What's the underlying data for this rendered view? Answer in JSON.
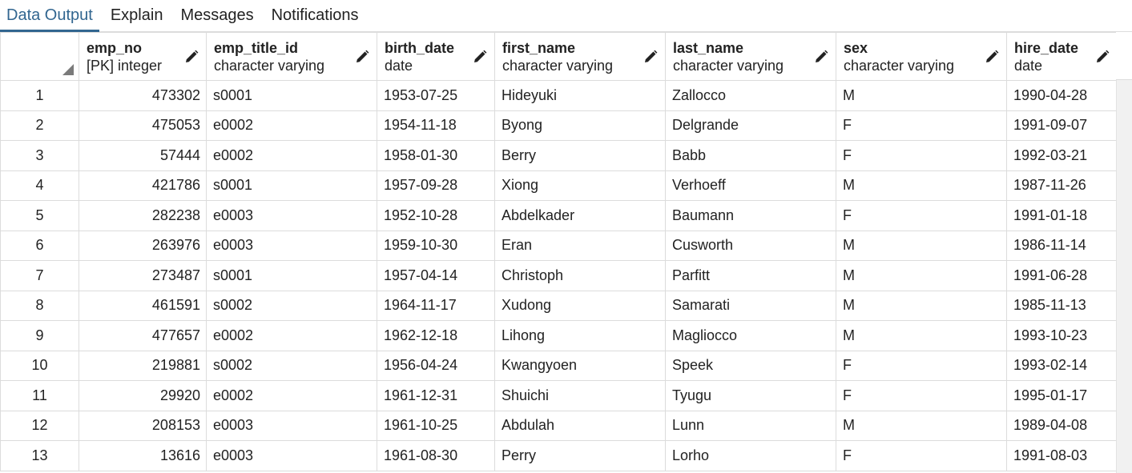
{
  "tabs": [
    {
      "label": "Data Output",
      "active": true
    },
    {
      "label": "Explain",
      "active": false
    },
    {
      "label": "Messages",
      "active": false
    },
    {
      "label": "Notifications",
      "active": false
    }
  ],
  "columns": [
    {
      "name": "emp_no",
      "type": "[PK] integer"
    },
    {
      "name": "emp_title_id",
      "type": "character varying"
    },
    {
      "name": "birth_date",
      "type": "date"
    },
    {
      "name": "first_name",
      "type": "character varying"
    },
    {
      "name": "last_name",
      "type": "character varying"
    },
    {
      "name": "sex",
      "type": "character varying"
    },
    {
      "name": "hire_date",
      "type": "date"
    }
  ],
  "rows": [
    [
      "1",
      "473302",
      "s0001",
      "1953-07-25",
      "Hideyuki",
      "Zallocco",
      "M",
      "1990-04-28"
    ],
    [
      "2",
      "475053",
      "e0002",
      "1954-11-18",
      "Byong",
      "Delgrande",
      "F",
      "1991-09-07"
    ],
    [
      "3",
      "57444",
      "e0002",
      "1958-01-30",
      "Berry",
      "Babb",
      "F",
      "1992-03-21"
    ],
    [
      "4",
      "421786",
      "s0001",
      "1957-09-28",
      "Xiong",
      "Verhoeff",
      "M",
      "1987-11-26"
    ],
    [
      "5",
      "282238",
      "e0003",
      "1952-10-28",
      "Abdelkader",
      "Baumann",
      "F",
      "1991-01-18"
    ],
    [
      "6",
      "263976",
      "e0003",
      "1959-10-30",
      "Eran",
      "Cusworth",
      "M",
      "1986-11-14"
    ],
    [
      "7",
      "273487",
      "s0001",
      "1957-04-14",
      "Christoph",
      "Parfitt",
      "M",
      "1991-06-28"
    ],
    [
      "8",
      "461591",
      "s0002",
      "1964-11-17",
      "Xudong",
      "Samarati",
      "M",
      "1985-11-13"
    ],
    [
      "9",
      "477657",
      "e0002",
      "1962-12-18",
      "Lihong",
      "Magliocco",
      "M",
      "1993-10-23"
    ],
    [
      "10",
      "219881",
      "s0002",
      "1956-04-24",
      "Kwangyoen",
      "Speek",
      "F",
      "1993-02-14"
    ],
    [
      "11",
      "29920",
      "e0002",
      "1961-12-31",
      "Shuichi",
      "Tyugu",
      "F",
      "1995-01-17"
    ],
    [
      "12",
      "208153",
      "e0003",
      "1961-10-25",
      "Abdulah",
      "Lunn",
      "M",
      "1989-04-08"
    ],
    [
      "13",
      "13616",
      "e0003",
      "1961-08-30",
      "Perry",
      "Lorho",
      "F",
      "1991-08-03"
    ]
  ],
  "colors": {
    "accent": "#326690",
    "grid_line": "#dcdcdc"
  },
  "icons": {
    "edit": "pencil-icon",
    "select_all": "select-all-corner-icon"
  }
}
